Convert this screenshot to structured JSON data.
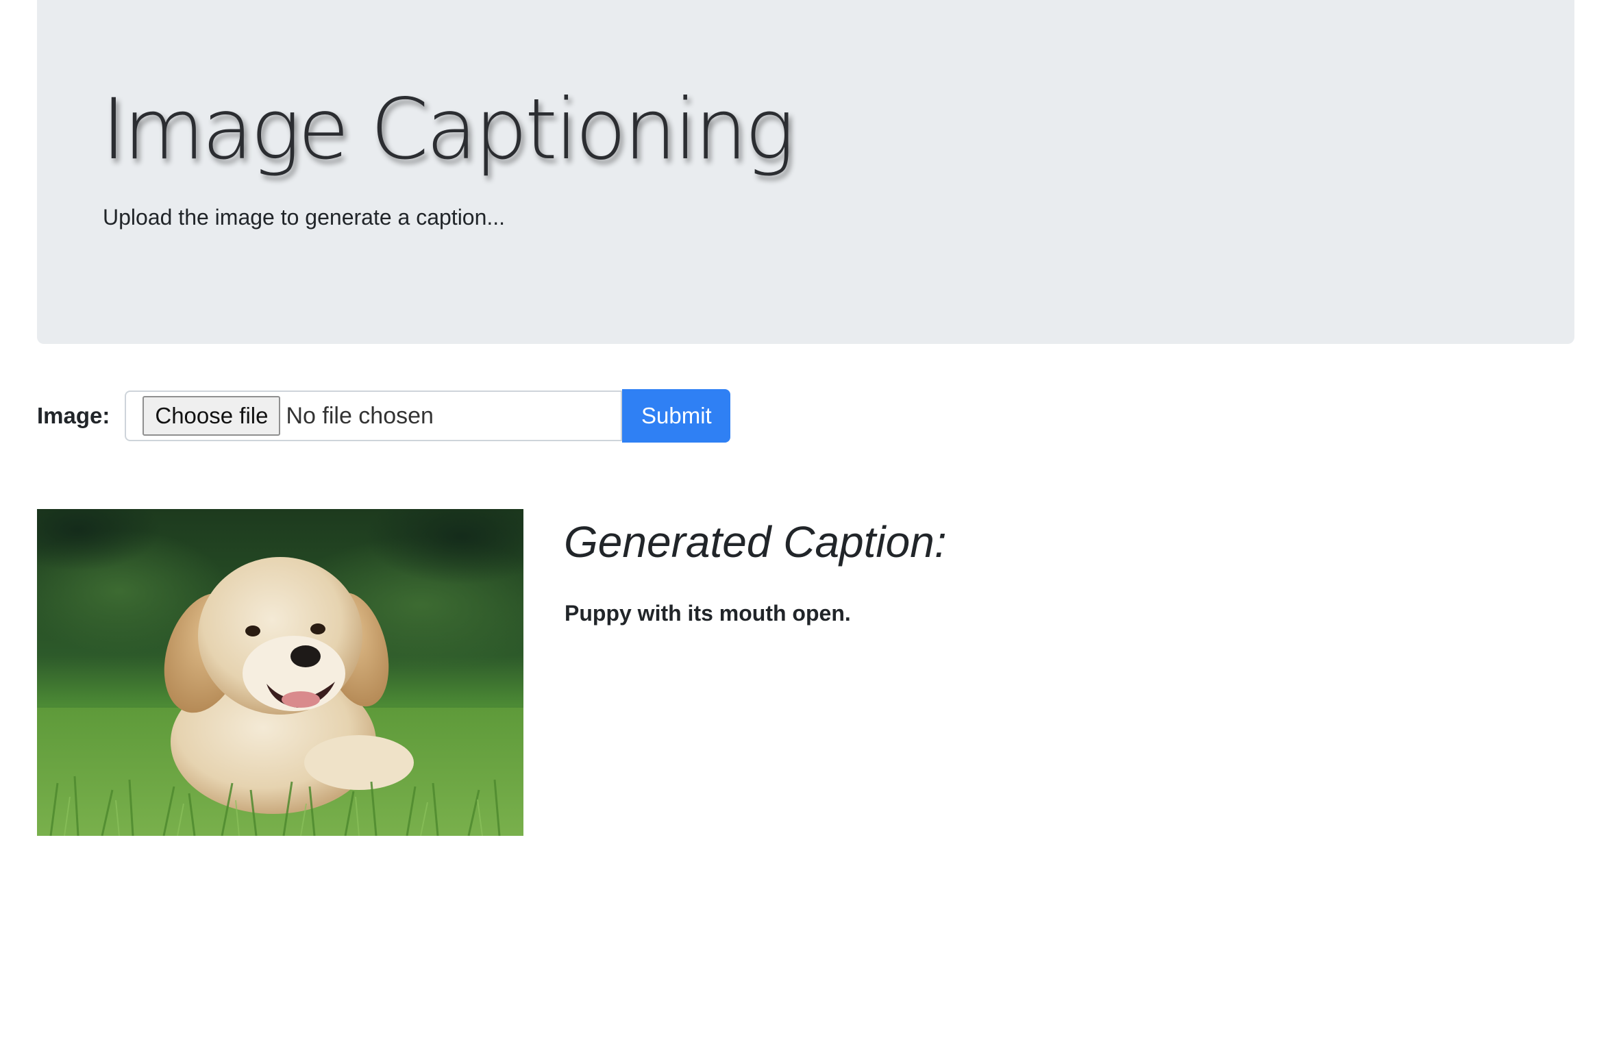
{
  "header": {
    "title": "Image Captioning",
    "subtitle": "Upload the image to generate a caption..."
  },
  "form": {
    "label": "Image:",
    "choose_file_label": "Choose file",
    "file_status": "No file chosen",
    "submit_label": "Submit"
  },
  "result": {
    "image_subject": "golden retriever puppy lying in grass",
    "heading": "Generated Caption:",
    "caption": "Puppy with its mouth open."
  },
  "colors": {
    "jumbotron_bg": "#e9ecef",
    "accent": "#2f80f4",
    "text": "#212529"
  }
}
